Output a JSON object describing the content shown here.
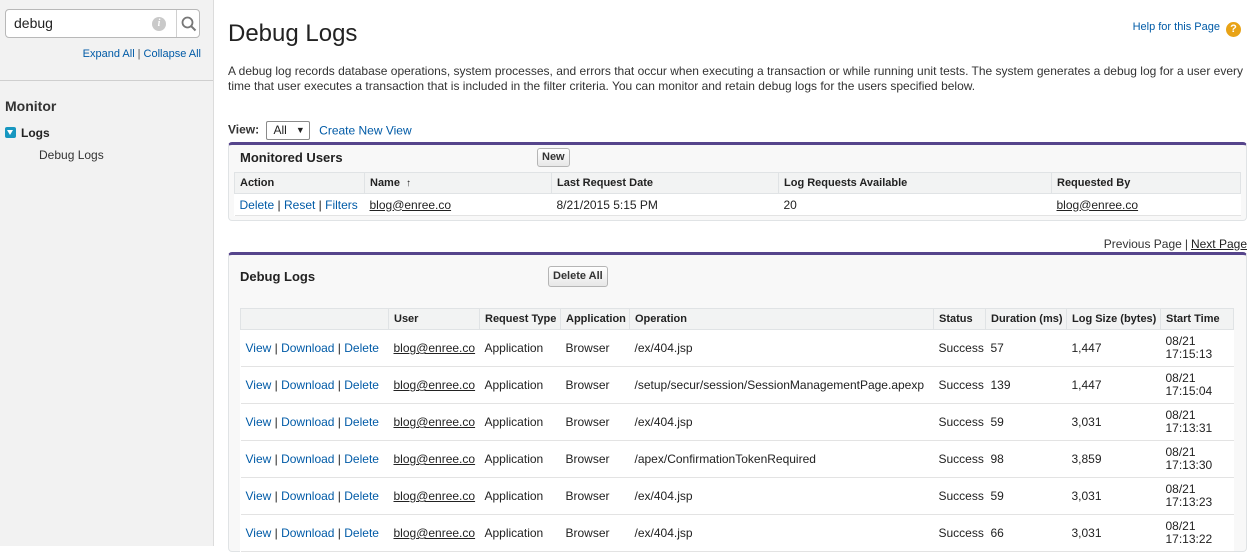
{
  "sidebar": {
    "search_value": "debug",
    "expand_all": "Expand All",
    "collapse_all": "Collapse All",
    "separator": "|",
    "monitor_heading": "Monitor",
    "logs_label": "Logs",
    "debug_logs_item": "Debug Logs"
  },
  "page": {
    "title": "Debug Logs",
    "help_link": "Help for this Page",
    "help_icon_glyph": "?",
    "description": "A debug log records database operations, system processes, and errors that occur when executing a transaction or while running unit tests. The system generates a debug log for a user every time that user executes a transaction that is included in the filter criteria. You can monitor and retain debug logs for the users specified below.",
    "view_label": "View:",
    "view_selected": "All",
    "create_new_view": "Create New View"
  },
  "monitored_users": {
    "title": "Monitored Users",
    "new_button": "New",
    "columns": [
      "Action",
      "Name",
      "Last Request Date",
      "Log Requests Available",
      "Requested By"
    ],
    "sort_glyph": "↑",
    "rows": [
      {
        "actions": [
          "Delete",
          "Reset",
          "Filters"
        ],
        "name": "blog@enree.co",
        "last_request_date": "8/21/2015 5:15 PM",
        "log_requests_available": "20",
        "requested_by": "blog@enree.co"
      }
    ]
  },
  "pager": {
    "previous": "Previous Page",
    "separator": "|",
    "next": "Next Page"
  },
  "debug_logs": {
    "title": "Debug Logs",
    "delete_all_button": "Delete All",
    "columns": [
      "",
      "User",
      "Request Type",
      "Application",
      "Operation",
      "Status",
      "Duration (ms)",
      "Log Size (bytes)",
      "Start Time"
    ],
    "action_labels": [
      "View",
      "Download",
      "Delete"
    ],
    "rows": [
      {
        "user": "blog@enree.co",
        "request_type": "Application",
        "application": "Browser",
        "operation": "/ex/404.jsp",
        "status": "Success",
        "duration": "57",
        "log_size": "1,447",
        "start_date": "08/21",
        "start_time": "17:15:13"
      },
      {
        "user": "blog@enree.co",
        "request_type": "Application",
        "application": "Browser",
        "operation": "/setup/secur/session/SessionManagementPage.apexp",
        "status": "Success",
        "duration": "139",
        "log_size": "1,447",
        "start_date": "08/21",
        "start_time": "17:15:04"
      },
      {
        "user": "blog@enree.co",
        "request_type": "Application",
        "application": "Browser",
        "operation": "/ex/404.jsp",
        "status": "Success",
        "duration": "59",
        "log_size": "3,031",
        "start_date": "08/21",
        "start_time": "17:13:31"
      },
      {
        "user": "blog@enree.co",
        "request_type": "Application",
        "application": "Browser",
        "operation": "/apex/ConfirmationTokenRequired",
        "status": "Success",
        "duration": "98",
        "log_size": "3,859",
        "start_date": "08/21",
        "start_time": "17:13:30"
      },
      {
        "user": "blog@enree.co",
        "request_type": "Application",
        "application": "Browser",
        "operation": "/ex/404.jsp",
        "status": "Success",
        "duration": "59",
        "log_size": "3,031",
        "start_date": "08/21",
        "start_time": "17:13:23"
      },
      {
        "user": "blog@enree.co",
        "request_type": "Application",
        "application": "Browser",
        "operation": "/ex/404.jsp",
        "status": "Success",
        "duration": "66",
        "log_size": "3,031",
        "start_date": "08/21",
        "start_time": "17:13:22"
      }
    ]
  },
  "colors": {
    "link": "#015ba7",
    "panel_accent": "#56458c",
    "sidebar_bg": "#f2f2f2",
    "toggle_icon": "#1797c0",
    "help_icon": "#e8a317"
  },
  "icons": {
    "search": "search-icon",
    "info": "info-icon",
    "help": "help-icon",
    "tree_toggle": "tree-toggle-icon",
    "dropdown": "chevron-down-icon"
  }
}
